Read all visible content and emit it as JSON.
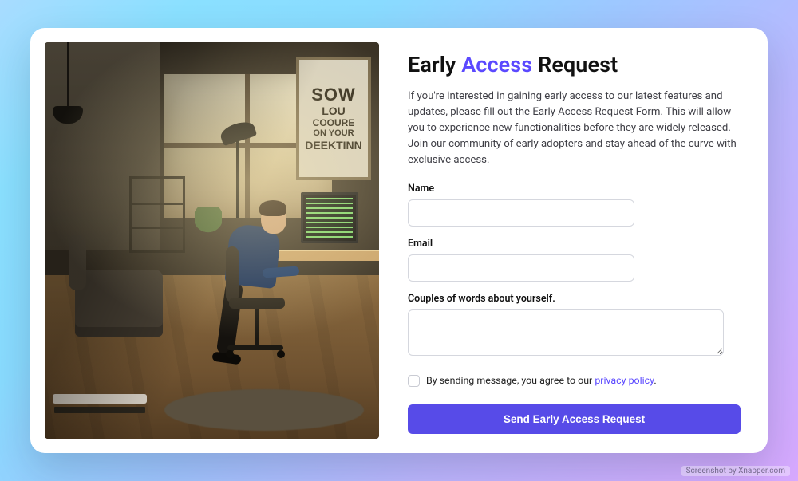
{
  "title": {
    "pre": "Early ",
    "accent": "Access",
    "post": " Request"
  },
  "description": "If you're interested in gaining early access to our latest features and updates, please fill out the Early Access Request Form. This will allow you to experience new functionalities before they are widely released. Join our community of early adopters and stay ahead of the curve with exclusive access.",
  "form": {
    "name": {
      "label": "Name",
      "value": ""
    },
    "email": {
      "label": "Email",
      "value": ""
    },
    "about": {
      "label": "Couples of words about yourself.",
      "value": ""
    },
    "consent": {
      "checked": false,
      "text_pre": "By sending message, you agree to our ",
      "link_text": "privacy policy",
      "text_post": "."
    },
    "submit_label": "Send Early Access Request"
  },
  "poster": {
    "l1": "SOW",
    "l2": "LOU",
    "l3": "COOURE",
    "l4": "ON YOUR",
    "l5": "DEEKTINN"
  },
  "accent_color": "#5b49ff",
  "watermark": "Screenshot by Xnapper.com"
}
